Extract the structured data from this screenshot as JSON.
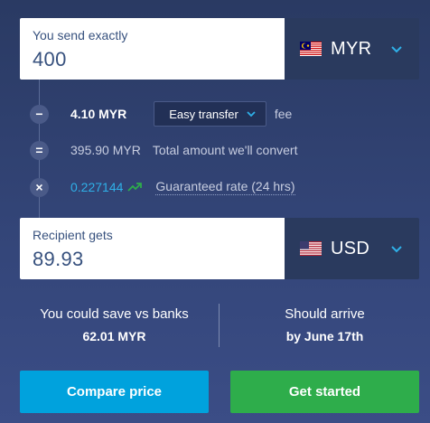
{
  "send": {
    "label": "You send exactly",
    "value": "400",
    "currency": "MYR",
    "flag": "malaysia-flag"
  },
  "fees": {
    "fee_amount": "4.10 MYR",
    "transfer_type": "Easy transfer",
    "fee_label": "fee",
    "convert_amount": "395.90 MYR",
    "convert_label": "Total amount we'll convert",
    "rate_value": "0.227144",
    "rate_label": "Guaranteed rate (24 hrs)",
    "op_minus": "−",
    "op_equals": "=",
    "op_times": "×"
  },
  "receive": {
    "label": "Recipient gets",
    "value": "89.93",
    "currency": "USD",
    "flag": "usa-flag"
  },
  "savings": {
    "title": "You could save vs banks",
    "amount": "62.01 MYR"
  },
  "arrival": {
    "title": "Should arrive",
    "date": "by June 17th"
  },
  "buttons": {
    "compare": "Compare price",
    "start": "Get started"
  },
  "colors": {
    "accent_blue": "#00a2dd",
    "accent_green": "#2ead4b",
    "rate_blue": "#2fb0e8",
    "background": "#34467a"
  }
}
